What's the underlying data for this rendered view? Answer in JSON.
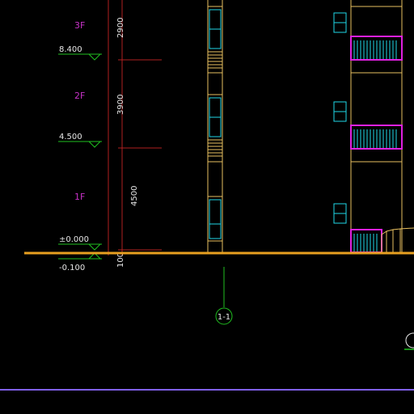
{
  "drawing": {
    "floors": [
      {
        "label": "3F"
      },
      {
        "label": "2F"
      },
      {
        "label": "1F"
      }
    ],
    "elevations": [
      {
        "label": "8.400"
      },
      {
        "label": "4.500"
      },
      {
        "label": "±0.000"
      },
      {
        "label": "-0.100"
      }
    ],
    "dimensions": [
      {
        "label": "2900"
      },
      {
        "label": "3900"
      },
      {
        "label": "4500"
      },
      {
        "label": "100"
      }
    ],
    "axis_marker": {
      "label": "1-1"
    },
    "colors": {
      "background": "#000000",
      "ground": "#e8a020",
      "floor_label": "#c832c8",
      "elevation_symbol": "#20c020",
      "dimension_line": "#b02020",
      "window": "#20d8e8",
      "wall": "#e8c060",
      "balcony_rail": "#e020e0",
      "border": "#8060e8"
    }
  }
}
